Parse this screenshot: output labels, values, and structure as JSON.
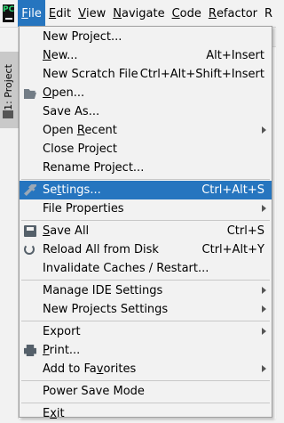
{
  "app": {
    "logo_text": "PC",
    "project_tab": "1: Project"
  },
  "menubar": [
    {
      "id": "file",
      "mnemonic": "F",
      "rest": "ile"
    },
    {
      "id": "edit",
      "mnemonic": "E",
      "rest": "dit"
    },
    {
      "id": "view",
      "mnemonic": "V",
      "rest": "iew"
    },
    {
      "id": "navigate",
      "mnemonic": "N",
      "rest": "avigate"
    },
    {
      "id": "code",
      "mnemonic": "C",
      "rest": "ode"
    },
    {
      "id": "refactor",
      "mnemonic": "R",
      "rest": "efactor"
    },
    {
      "id": "run",
      "mnemonic": "R",
      "rest": ""
    }
  ],
  "file_menu": {
    "new_project": "New Project...",
    "new": {
      "pre": "",
      "mn": "N",
      "post": "ew...",
      "shortcut": "Alt+Insert"
    },
    "new_scratch": {
      "label": "New Scratch File",
      "shortcut": "Ctrl+Alt+Shift+Insert"
    },
    "open": {
      "pre": "",
      "mn": "O",
      "post": "pen..."
    },
    "save_as": "Save As...",
    "open_recent": {
      "pre": "Open ",
      "mn": "R",
      "post": "ecent"
    },
    "close_project": "Close Project",
    "rename_project": "Rename Project...",
    "settings": {
      "pre": "Se",
      "mn": "t",
      "post": "tings...",
      "shortcut": "Ctrl+Alt+S"
    },
    "file_properties": "File Properties",
    "save_all": {
      "pre": "",
      "mn": "S",
      "post": "ave All",
      "shortcut": "Ctrl+S"
    },
    "reload": {
      "label": "Reload All from Disk",
      "shortcut": "Ctrl+Alt+Y"
    },
    "invalidate": "Invalidate Caches / Restart...",
    "manage_ide": "Manage IDE Settings",
    "new_projects_settings": "New Projects Settings",
    "export": "Export",
    "print": {
      "pre": "",
      "mn": "P",
      "post": "rint..."
    },
    "add_favorites": {
      "pre": "Add to Fa",
      "mn": "v",
      "post": "orites"
    },
    "power_save": "Power Save Mode",
    "exit": {
      "pre": "E",
      "mn": "x",
      "post": "it"
    }
  },
  "colors": {
    "highlight": "#2675bf",
    "menu_bg": "#f2f2f2"
  },
  "icons": [
    "folder-open-icon",
    "wrench-icon",
    "save-icon",
    "reload-icon",
    "printer-icon"
  ]
}
